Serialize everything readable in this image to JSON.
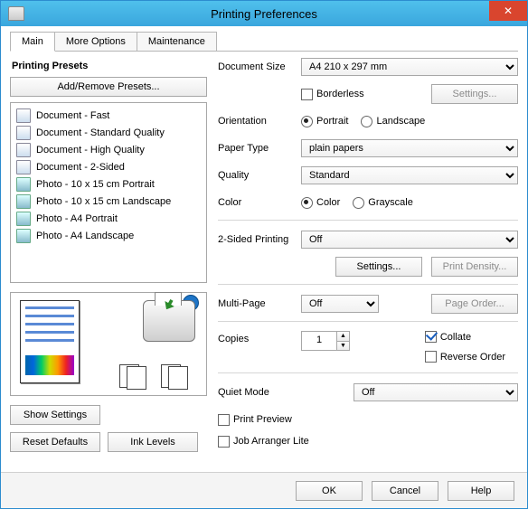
{
  "window": {
    "title": "Printing Preferences"
  },
  "tabs": {
    "main": "Main",
    "more": "More Options",
    "maint": "Maintenance"
  },
  "presets_title": "Printing Presets",
  "add_remove": "Add/Remove Presets...",
  "presets": [
    "Document - Fast",
    "Document - Standard Quality",
    "Document - High Quality",
    "Document - 2-Sided",
    "Photo - 10 x 15 cm Portrait",
    "Photo - 10 x 15 cm Landscape",
    "Photo - A4 Portrait",
    "Photo - A4 Landscape"
  ],
  "show_settings": "Show Settings",
  "reset_defaults": "Reset Defaults",
  "ink_levels": "Ink Levels",
  "labels": {
    "doc_size": "Document Size",
    "borderless": "Borderless",
    "orientation": "Orientation",
    "portrait": "Portrait",
    "landscape": "Landscape",
    "paper_type": "Paper Type",
    "quality": "Quality",
    "color": "Color",
    "grayscale": "Grayscale",
    "two_sided": "2-Sided Printing",
    "settings": "Settings...",
    "print_density": "Print Density...",
    "multi_page": "Multi-Page",
    "page_order": "Page Order...",
    "copies": "Copies",
    "collate": "Collate",
    "reverse": "Reverse Order",
    "quiet": "Quiet Mode",
    "print_preview": "Print Preview",
    "job_arranger": "Job Arranger Lite"
  },
  "values": {
    "doc_size": "A4 210 x 297 mm",
    "paper_type": "plain papers",
    "quality": "Standard",
    "two_sided": "Off",
    "multi_page": "Off",
    "copies": "1",
    "quiet": "Off"
  },
  "footer": {
    "ok": "OK",
    "cancel": "Cancel",
    "help": "Help"
  }
}
